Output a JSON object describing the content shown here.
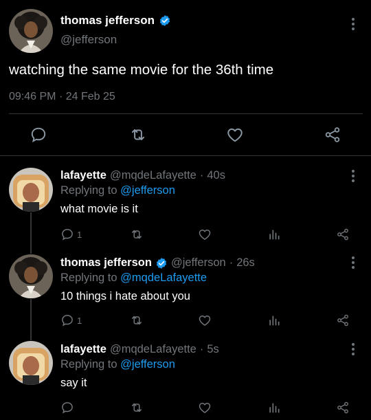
{
  "main_tweet": {
    "name": "thomas jefferson",
    "handle": "@jefferson",
    "text": "watching the same movie for the 36th time",
    "time": "09:46 PM",
    "separator": "·",
    "date": "24 Feb 25",
    "icons": [
      "reply-icon",
      "retweet-icon",
      "like-icon",
      "share-icon",
      "more-icon",
      "verified-badge-icon"
    ]
  },
  "replies": [
    {
      "name": "lafayette",
      "handle": "@mqdeLafayette",
      "time": "40s",
      "replying_prefix": "Replying to",
      "replying_to": "@jefferson",
      "text": "what movie is it",
      "reply_count": "1",
      "verified": false
    },
    {
      "name": "thomas jefferson",
      "handle": "@jefferson",
      "time": "26s",
      "replying_prefix": "Replying to",
      "replying_to": "@mqdeLafayette",
      "text": "10 things i hate about you",
      "reply_count": "1",
      "verified": true
    },
    {
      "name": "lafayette",
      "handle": "@mqdeLafayette",
      "time": "5s",
      "replying_prefix": "Replying to",
      "replying_to": "@jefferson",
      "text": "say it",
      "reply_count": "",
      "verified": false
    }
  ],
  "colors": {
    "background": "#000000",
    "text": "#e7e9ea",
    "muted": "#71767b",
    "link": "#1d9bf0",
    "divider": "#2f3336",
    "verified": "#1d9bf0"
  }
}
